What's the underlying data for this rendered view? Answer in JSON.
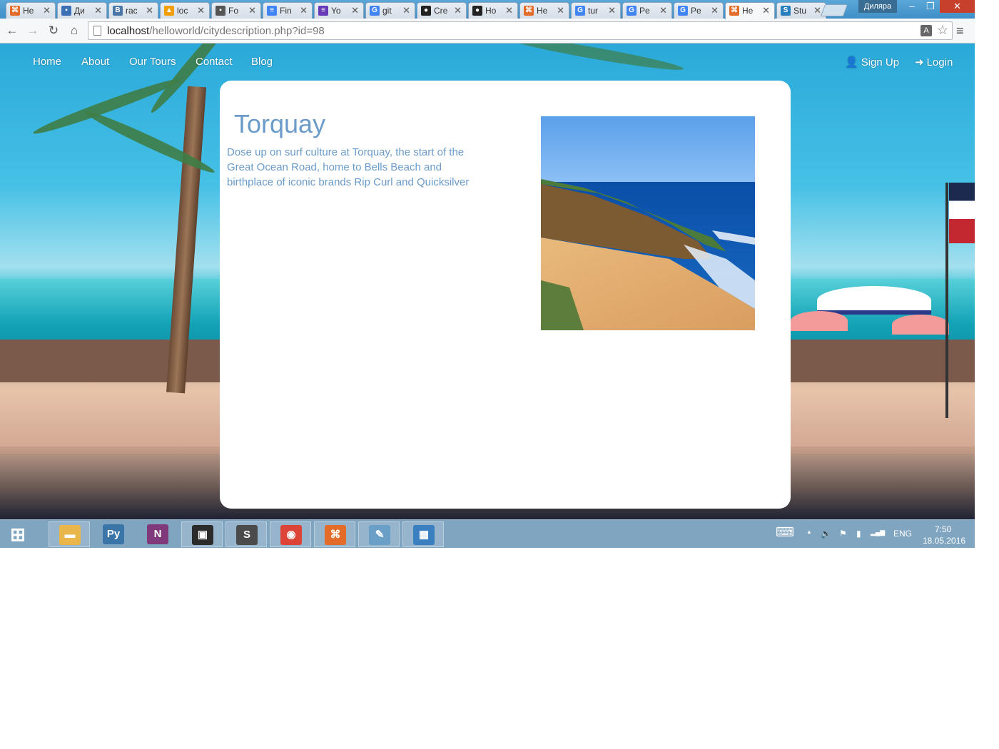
{
  "browser": {
    "tabs": [
      {
        "title": "He",
        "icon": "xampp-icon",
        "color": "#e36c2a",
        "glyph": "⌘"
      },
      {
        "title": "Ди",
        "icon": "chat-icon",
        "color": "#3b6fb6",
        "glyph": "▪"
      },
      {
        "title": "rac",
        "icon": "vk-icon",
        "color": "#4a76a8",
        "glyph": "B"
      },
      {
        "title": "loc",
        "icon": "phpmyadmin-icon",
        "color": "#f29f05",
        "glyph": "▲"
      },
      {
        "title": "Fo",
        "icon": "contact-icon",
        "color": "#555555",
        "glyph": "▪"
      },
      {
        "title": "Fin",
        "icon": "docs-icon",
        "color": "#4285f4",
        "glyph": "≡"
      },
      {
        "title": "Yo",
        "icon": "forms-icon",
        "color": "#673ab7",
        "glyph": "≡"
      },
      {
        "title": "git",
        "icon": "google-icon",
        "color": "#4285f4",
        "glyph": "G"
      },
      {
        "title": "Cre",
        "icon": "github-icon",
        "color": "#222222",
        "glyph": "●"
      },
      {
        "title": "Ho",
        "icon": "github-icon",
        "color": "#222222",
        "glyph": "●"
      },
      {
        "title": "He",
        "icon": "xampp-icon",
        "color": "#e36c2a",
        "glyph": "⌘"
      },
      {
        "title": "tur",
        "icon": "google-icon",
        "color": "#4285f4",
        "glyph": "G"
      },
      {
        "title": "Pe",
        "icon": "google-icon",
        "color": "#4285f4",
        "glyph": "G"
      },
      {
        "title": "Pe",
        "icon": "google-icon",
        "color": "#4285f4",
        "glyph": "G"
      },
      {
        "title": "He",
        "icon": "xampp-icon",
        "color": "#e36c2a",
        "glyph": "⌘",
        "active": true
      },
      {
        "title": "Stu",
        "icon": "stu-icon",
        "color": "#2a7fbf",
        "glyph": "S"
      }
    ],
    "close_glyph": "✕",
    "user_label": "Диляра",
    "window_controls": {
      "minimize": "–",
      "maximize": "❐",
      "close": "✕"
    },
    "back_glyph": "←",
    "forward_glyph": "→",
    "reload_glyph": "↻",
    "home_glyph": "⌂",
    "url_host": "localhost",
    "url_path": "/helloworld/citydescription.php?id=98",
    "translate_glyph": "A",
    "star_glyph": "☆",
    "menu_glyph": "≡"
  },
  "site": {
    "nav_left": [
      "Home",
      "About",
      "Our Tours",
      "Contact",
      "Blog"
    ],
    "nav_right": {
      "signup": {
        "label": "Sign Up",
        "glyph": "👤"
      },
      "login": {
        "label": "Login",
        "glyph": "➜"
      }
    },
    "city": {
      "name": "Torquay",
      "description": "Dose up on surf culture at Torquay, the start of the Great Ocean Road, home to Bells Beach and birthplace of iconic brands Rip Curl and Quicksilver"
    }
  },
  "taskbar": {
    "start_glyph": "⊞",
    "apps": [
      {
        "name": "file-explorer-icon",
        "glyph": "▬",
        "color": "#e8b64a",
        "pinned": true
      },
      {
        "name": "python-icon",
        "glyph": "Py",
        "color": "#3b74a6"
      },
      {
        "name": "onenote-icon",
        "glyph": "N",
        "color": "#80397b"
      },
      {
        "name": "terminal-icon",
        "glyph": "▣",
        "color": "#2b2b2b",
        "pinned": true
      },
      {
        "name": "sublime-icon",
        "glyph": "S",
        "color": "#4b4b4b",
        "pinned": true
      },
      {
        "name": "chrome-icon",
        "glyph": "◉",
        "color": "#db4437",
        "pinned": true
      },
      {
        "name": "xampp-icon",
        "glyph": "⌘",
        "color": "#e36c2a",
        "pinned": true
      },
      {
        "name": "paint-icon",
        "glyph": "✎",
        "color": "#6aa0c8",
        "pinned": true
      },
      {
        "name": "photos-icon",
        "glyph": "▦",
        "color": "#3a7fc0",
        "pinned": true
      }
    ],
    "keyboard_glyph": "⌨",
    "tray_up_glyph": "▲",
    "volume_glyph": "🔈",
    "flag_glyph": "⚑",
    "battery_glyph": "▮",
    "signal_glyph": "▂▄▆",
    "lang": "ENG",
    "time": "7:50",
    "date": "18.05.2016"
  }
}
